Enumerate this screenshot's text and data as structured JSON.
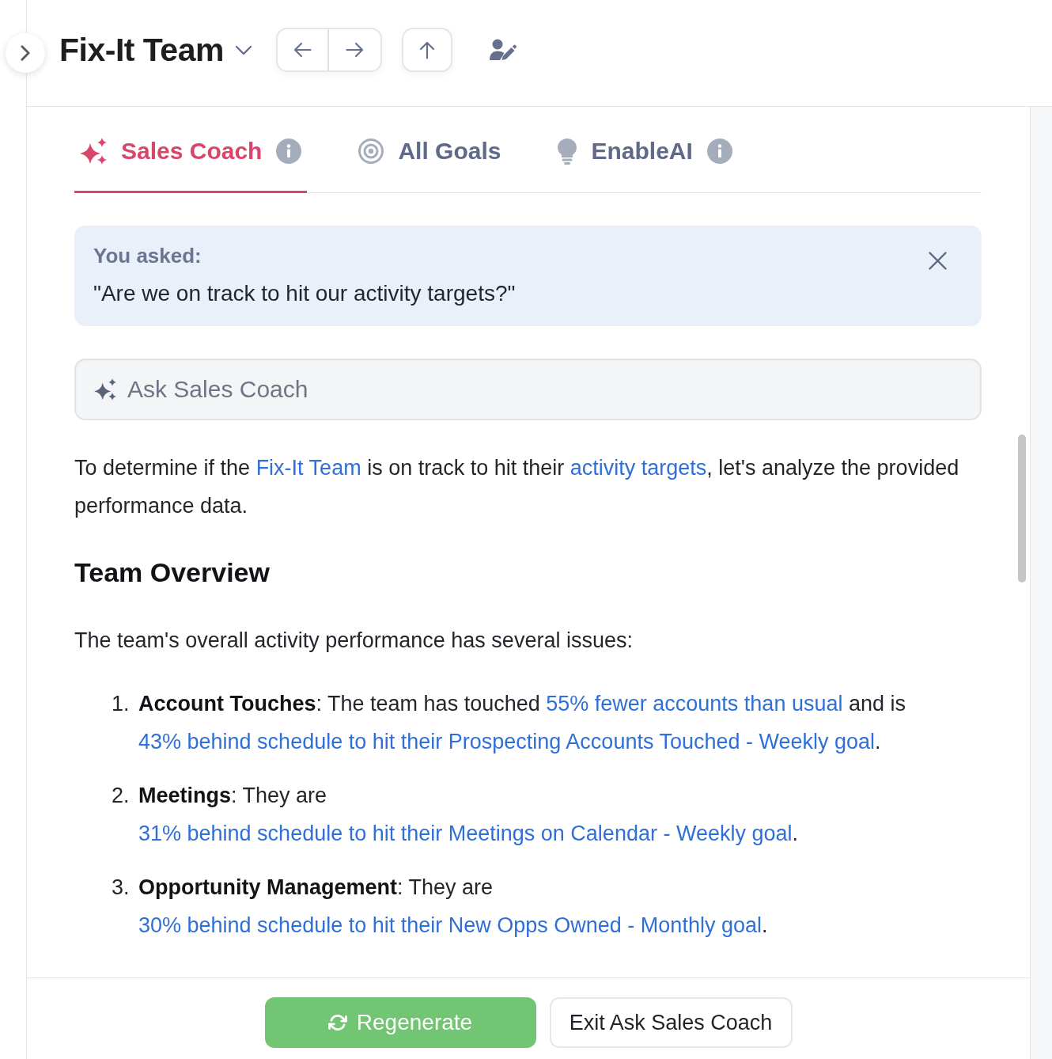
{
  "header": {
    "title": "Fix-It Team"
  },
  "tabs": [
    {
      "label": "Sales Coach",
      "selected": true,
      "info": true
    },
    {
      "label": "All Goals",
      "selected": false,
      "info": false
    },
    {
      "label": "EnableAI",
      "selected": false,
      "info": true
    }
  ],
  "question": {
    "label": "You asked:",
    "text": "\"Are we on track to hit our activity targets?\""
  },
  "ask_field": {
    "placeholder": "Ask Sales Coach"
  },
  "answer": {
    "intro": [
      {
        "kind": "text",
        "text": "To determine if the "
      },
      {
        "kind": "link",
        "text": "Fix-It Team"
      },
      {
        "kind": "text",
        "text": " is on track to hit their "
      },
      {
        "kind": "link",
        "text": "activity targets"
      },
      {
        "kind": "text",
        "text": ", let's analyze the provided performance data."
      }
    ],
    "heading": "Team Overview",
    "summary": "The team's overall activity performance has several issues:",
    "items": [
      {
        "number": "1.",
        "segments": [
          {
            "kind": "text",
            "text": "**Account Touches**: The team has touched "
          },
          {
            "kind": "link",
            "text": "55% fewer accounts than usual"
          },
          {
            "kind": "text",
            "text": " and is "
          },
          {
            "kind": "link",
            "text": "43% behind schedule to hit their Prospecting Accounts Touched - Weekly goal"
          },
          {
            "kind": "text",
            "text": "."
          }
        ]
      },
      {
        "number": "2.",
        "segments": [
          {
            "kind": "text",
            "text": "**Meetings**: They are "
          },
          {
            "kind": "link",
            "text": "31% behind schedule to hit their Meetings on Calendar - Weekly goal"
          },
          {
            "kind": "text",
            "text": "."
          }
        ]
      },
      {
        "number": "3.",
        "segments": [
          {
            "kind": "text",
            "text": "**Opportunity Management**: They are "
          },
          {
            "kind": "link",
            "text": "30% behind schedule to hit their New Opps Owned - Monthly goal"
          },
          {
            "kind": "text",
            "text": "."
          }
        ]
      }
    ]
  },
  "footer": {
    "buttons": [
      {
        "label": "Regenerate",
        "kind": "primary"
      },
      {
        "label": "Exit Ask Sales Coach",
        "kind": "secondary"
      }
    ]
  }
}
